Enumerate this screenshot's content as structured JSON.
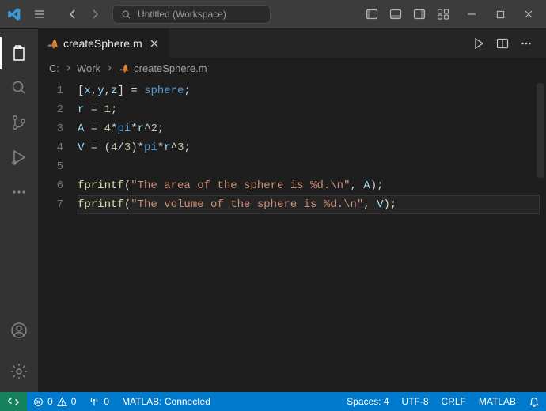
{
  "title": {
    "search_placeholder": "Untitled (Workspace)"
  },
  "tabs": [
    {
      "label": "createSphere.m",
      "icon": "matlab"
    }
  ],
  "breadcrumb": {
    "root": "C:",
    "folder": "Work",
    "file": "createSphere.m"
  },
  "code_lines": [
    {
      "n": "1",
      "tokens": [
        {
          "t": "[",
          "c": "p"
        },
        {
          "t": "x",
          "c": "id"
        },
        {
          "t": ",",
          "c": "p"
        },
        {
          "t": "y",
          "c": "id"
        },
        {
          "t": ",",
          "c": "p"
        },
        {
          "t": "z",
          "c": "id"
        },
        {
          "t": "] = ",
          "c": "p"
        },
        {
          "t": "sphere",
          "c": "kw"
        },
        {
          "t": ";",
          "c": "p"
        }
      ]
    },
    {
      "n": "2",
      "tokens": [
        {
          "t": "r",
          "c": "id"
        },
        {
          "t": " = ",
          "c": "p"
        },
        {
          "t": "1",
          "c": "num"
        },
        {
          "t": ";",
          "c": "p"
        }
      ]
    },
    {
      "n": "3",
      "tokens": [
        {
          "t": "A",
          "c": "id"
        },
        {
          "t": " = ",
          "c": "p"
        },
        {
          "t": "4",
          "c": "num"
        },
        {
          "t": "*",
          "c": "p"
        },
        {
          "t": "pi",
          "c": "kw"
        },
        {
          "t": "*",
          "c": "p"
        },
        {
          "t": "r",
          "c": "id"
        },
        {
          "t": "^",
          "c": "p"
        },
        {
          "t": "2",
          "c": "num"
        },
        {
          "t": ";",
          "c": "p"
        }
      ]
    },
    {
      "n": "4",
      "tokens": [
        {
          "t": "V",
          "c": "id"
        },
        {
          "t": " = (",
          "c": "p"
        },
        {
          "t": "4",
          "c": "num"
        },
        {
          "t": "/",
          "c": "p"
        },
        {
          "t": "3",
          "c": "num"
        },
        {
          "t": ")*",
          "c": "p"
        },
        {
          "t": "pi",
          "c": "kw"
        },
        {
          "t": "*",
          "c": "p"
        },
        {
          "t": "r",
          "c": "id"
        },
        {
          "t": "^",
          "c": "p"
        },
        {
          "t": "3",
          "c": "num"
        },
        {
          "t": ";",
          "c": "p"
        }
      ]
    },
    {
      "n": "5",
      "tokens": []
    },
    {
      "n": "6",
      "tokens": [
        {
          "t": "fprintf",
          "c": "fn"
        },
        {
          "t": "(",
          "c": "p"
        },
        {
          "t": "\"The area of the sphere is %d.\\n\"",
          "c": "str"
        },
        {
          "t": ", ",
          "c": "p"
        },
        {
          "t": "A",
          "c": "id"
        },
        {
          "t": ");",
          "c": "p"
        }
      ]
    },
    {
      "n": "7",
      "current": true,
      "tokens": [
        {
          "t": "fprintf",
          "c": "fn"
        },
        {
          "t": "(",
          "c": "p"
        },
        {
          "t": "\"The volume of the sphere is %d.\\n\"",
          "c": "str"
        },
        {
          "t": ", ",
          "c": "p"
        },
        {
          "t": "V",
          "c": "id"
        },
        {
          "t": ");",
          "c": "p"
        }
      ]
    }
  ],
  "status": {
    "errors": "0",
    "warnings": "0",
    "ports": "0",
    "matlab": "MATLAB: Connected",
    "spaces": "Spaces: 4",
    "encoding": "UTF-8",
    "eol": "CRLF",
    "language": "MATLAB"
  },
  "icons": {
    "matlab_stops": [
      {
        "o": "0%",
        "c": "#2aa9e0"
      },
      {
        "o": "45%",
        "c": "#d36a2f"
      },
      {
        "o": "100%",
        "c": "#f5b547"
      }
    ]
  }
}
